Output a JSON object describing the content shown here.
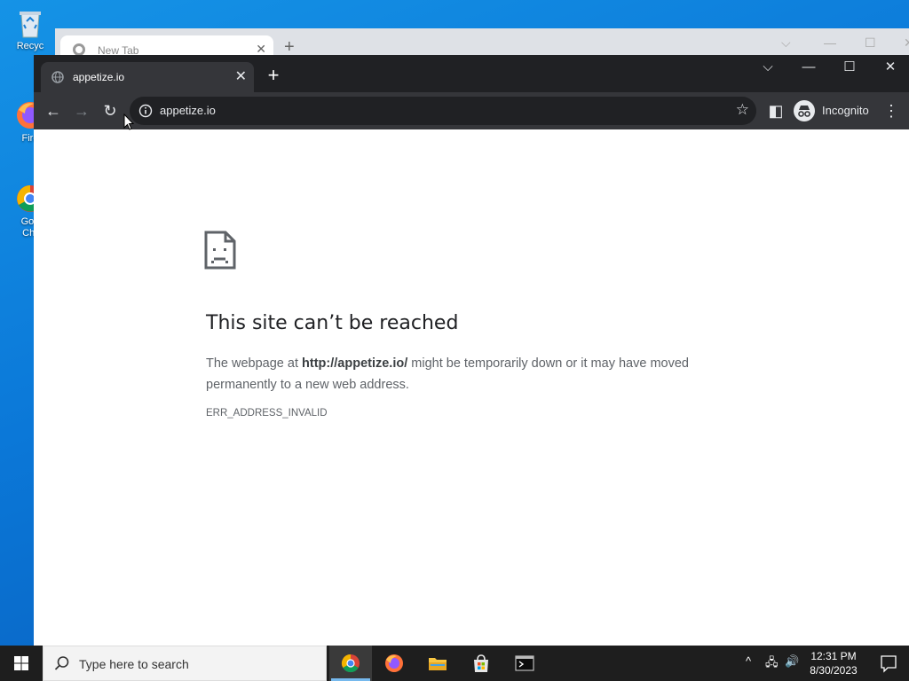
{
  "desktop": {
    "icons": [
      {
        "label": "Recyc",
        "icon": "recycle-bin-icon"
      },
      {
        "label": "Fire",
        "icon": "firefox-icon"
      },
      {
        "label": "Goo\nChr",
        "icon": "google-chrome-icon"
      }
    ]
  },
  "background_window": {
    "tab_title": "New Tab",
    "new_tab_symbol": "+",
    "controls": {
      "dropdown": "⌵",
      "minimize": "—",
      "maximize": "☐",
      "close": "✕"
    }
  },
  "browser": {
    "tab": {
      "title": "appetize.io",
      "close_symbol": "✕"
    },
    "new_tab_symbol": "+",
    "window_controls": {
      "dropdown": "⌵",
      "minimize": "—",
      "maximize": "☐",
      "close": "✕"
    },
    "toolbar": {
      "back_symbol": "←",
      "forward_symbol": "→",
      "reload_symbol": "↻",
      "url": "appetize.io",
      "bookmark_symbol": "☆",
      "side_panel_symbol": "◧",
      "incognito_label": "Incognito",
      "menu_symbol": "⋮"
    },
    "colors": {
      "tabstrip": "#202124",
      "toolbar": "#35363a",
      "omnibox": "#202124"
    }
  },
  "error_page": {
    "title": "This site can’t be reached",
    "description_prefix": "The webpage at ",
    "description_url": "http://appetize.io/",
    "description_suffix": " might be temporarily down or it may have moved permanently to a new web address.",
    "error_code": "ERR_ADDRESS_INVALID"
  },
  "taskbar": {
    "search_placeholder": "Type here to search",
    "apps": [
      {
        "name": "chrome",
        "active": true
      },
      {
        "name": "firefox",
        "active": false
      },
      {
        "name": "file-explorer",
        "active": false
      },
      {
        "name": "microsoft-store",
        "active": false
      },
      {
        "name": "terminal",
        "active": false
      }
    ],
    "tray": {
      "chevron": "^",
      "network": "🖧",
      "volume": "🔊"
    },
    "clock": {
      "time": "12:31 PM",
      "date": "8/30/2023"
    }
  }
}
